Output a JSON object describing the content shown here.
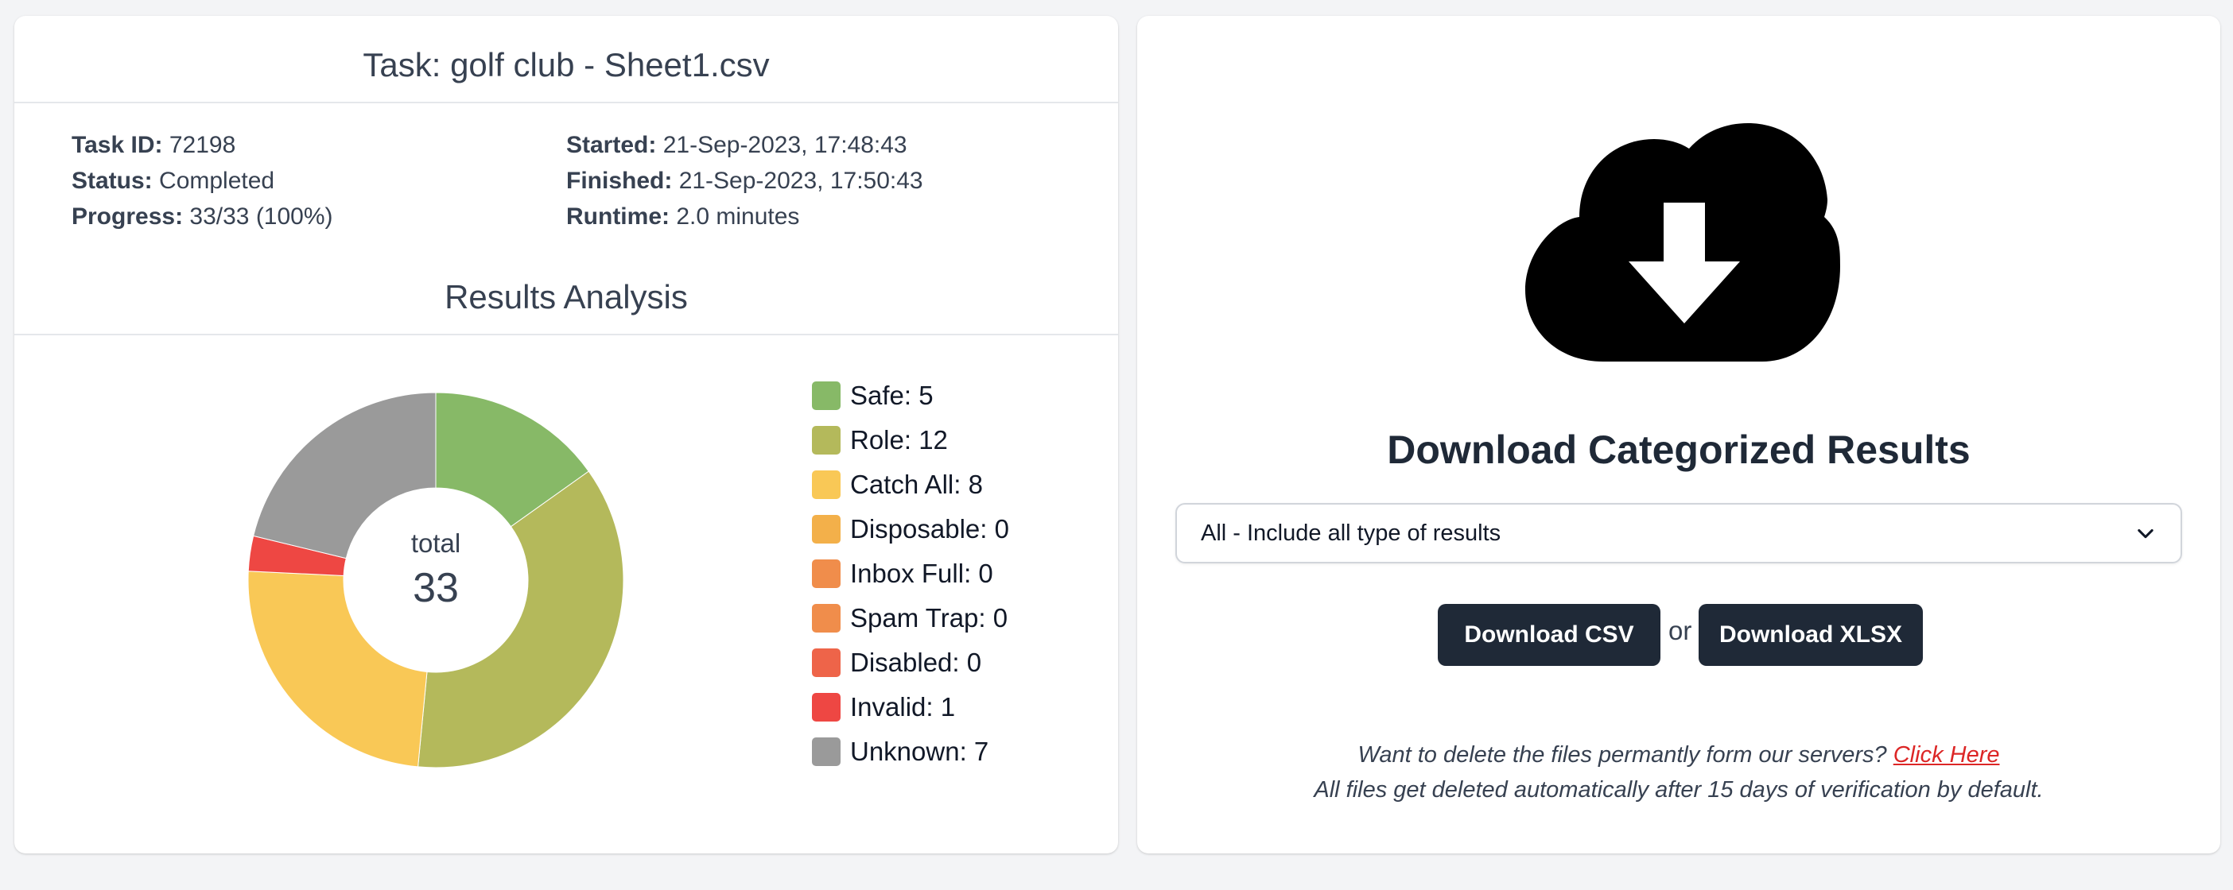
{
  "task": {
    "title": "Task: golf club - Sheet1.csv",
    "id_label": "Task ID:",
    "id_value": "72198",
    "status_label": "Status:",
    "status_value": "Completed",
    "progress_label": "Progress:",
    "progress_value": "33/33 (100%)",
    "started_label": "Started:",
    "started_value": "21-Sep-2023, 17:48:43",
    "finished_label": "Finished:",
    "finished_value": "21-Sep-2023, 17:50:43",
    "runtime_label": "Runtime:",
    "runtime_value": "2.0 minutes"
  },
  "analysis": {
    "title": "Results Analysis",
    "center_label": "total",
    "center_value": "33"
  },
  "chart_data": {
    "type": "pie",
    "donut": true,
    "total": 33,
    "series": [
      {
        "name": "Safe",
        "value": 5,
        "label": "Safe: 5",
        "color": "#87b967"
      },
      {
        "name": "Role",
        "value": 12,
        "label": "Role: 12",
        "color": "#b4b95b"
      },
      {
        "name": "Catch All",
        "value": 8,
        "label": "Catch All: 8",
        "color": "#f9c856"
      },
      {
        "name": "Disposable",
        "value": 0,
        "label": "Disposable: 0",
        "color": "#f3b04a"
      },
      {
        "name": "Inbox Full",
        "value": 0,
        "label": "Inbox Full: 0",
        "color": "#f08d4b"
      },
      {
        "name": "Spam Trap",
        "value": 0,
        "label": "Spam Trap: 0",
        "color": "#f08d4b"
      },
      {
        "name": "Disabled",
        "value": 0,
        "label": "Disabled: 0",
        "color": "#ee6449"
      },
      {
        "name": "Invalid",
        "value": 1,
        "label": "Invalid: 1",
        "color": "#ee4743"
      },
      {
        "name": "Unknown",
        "value": 7,
        "label": "Unknown: 7",
        "color": "#9a9a9a"
      }
    ],
    "legend_position": "right"
  },
  "download": {
    "icon": "cloud-download-icon",
    "title": "Download Categorized Results",
    "select_value": "All - Include all type of results",
    "csv_label": "Download CSV",
    "or_label": "or",
    "xlsx_label": "Download XLSX",
    "note_text": "Want to delete the files permantly form our servers?",
    "note_link": "Click Here",
    "note_line2": "All files get deleted automatically after 15 days of verification by default."
  },
  "colors": {
    "button_bg": "#1f2937",
    "link": "#dc2626",
    "page_bg": "#f3f4f6"
  }
}
